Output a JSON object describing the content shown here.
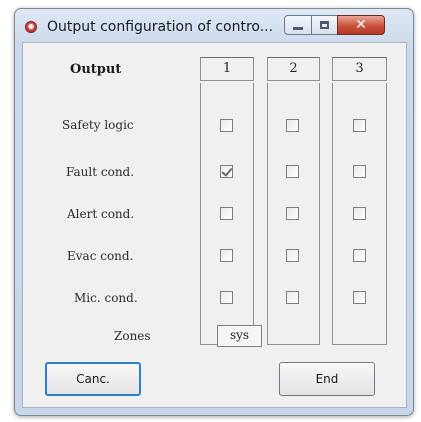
{
  "window": {
    "title": "Output configuration of contro...",
    "close_glyph": "✕"
  },
  "table": {
    "output_header": "Output",
    "columns": [
      "1",
      "2",
      "3"
    ],
    "rows": [
      {
        "label": "Safety logic",
        "checks": [
          false,
          false,
          false
        ]
      },
      {
        "label": "Fault cond.",
        "checks": [
          true,
          false,
          false
        ]
      },
      {
        "label": "Alert cond.",
        "checks": [
          false,
          false,
          false
        ]
      },
      {
        "label": "Evac cond.",
        "checks": [
          false,
          false,
          false
        ]
      },
      {
        "label": "Mic. cond.",
        "checks": [
          false,
          false,
          false
        ]
      }
    ],
    "zones_label": "Zones",
    "zones_value": "sys"
  },
  "buttons": {
    "cancel_label": "Canc.",
    "end_label": "End"
  }
}
